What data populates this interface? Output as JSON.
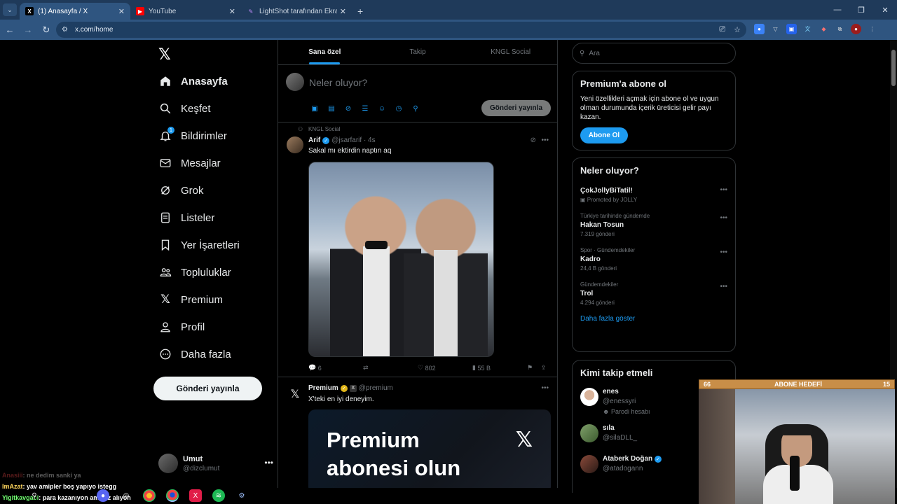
{
  "browser": {
    "tabs": [
      {
        "title": "(1) Anasayfa / X",
        "active": true
      },
      {
        "title": "YouTube",
        "active": false
      },
      {
        "title": "LightShot tarafından Ekran Gör",
        "active": false
      }
    ],
    "url": "x.com/home"
  },
  "sidebar": {
    "items": [
      {
        "label": "Anasayfa",
        "icon": "home-icon"
      },
      {
        "label": "Keşfet",
        "icon": "search-icon"
      },
      {
        "label": "Bildirimler",
        "icon": "bell-icon",
        "badge": "1"
      },
      {
        "label": "Mesajlar",
        "icon": "mail-icon"
      },
      {
        "label": "Grok",
        "icon": "grok-icon"
      },
      {
        "label": "Listeler",
        "icon": "list-icon"
      },
      {
        "label": "Yer İşaretleri",
        "icon": "bookmark-icon"
      },
      {
        "label": "Topluluklar",
        "icon": "communities-icon"
      },
      {
        "label": "Premium",
        "icon": "x-logo-icon"
      },
      {
        "label": "Profil",
        "icon": "profile-icon"
      },
      {
        "label": "Daha fazla",
        "icon": "more-circle-icon"
      }
    ],
    "post_button": "Gönderi yayınla",
    "user": {
      "name": "Umut",
      "handle": "@dizclumut"
    }
  },
  "main": {
    "tabs": [
      "Sana özel",
      "Takip",
      "KNGL Social"
    ],
    "compose": {
      "placeholder": "Neler oluyor?",
      "post_button": "Gönderi yayınla"
    },
    "posts": [
      {
        "context": "KNGL Social",
        "name": "Arif",
        "handle": "@jsarfarif · 4s",
        "text": "Sakal mı ektirdin naptın aq",
        "replies": "6",
        "likes": "802",
        "views": "55 B"
      },
      {
        "name": "Premium",
        "handle": "@premium",
        "text": "X'teki en iyi deneyim.",
        "promo_line1": "Premium",
        "promo_line2": "abonesi olun"
      }
    ]
  },
  "right": {
    "search_placeholder": "Ara",
    "premium": {
      "title": "Premium'a abone ol",
      "text": "Yeni özellikleri açmak için abone ol ve uygun olman durumunda içerik üreticisi gelir payı kazan.",
      "button": "Abone Ol"
    },
    "trends": {
      "title": "Neler oluyor?",
      "items": [
        {
          "meta": "",
          "title": "ÇokJollyBiTatil!",
          "count": "Promoted by JOLLY"
        },
        {
          "meta": "Türkiye tarihinde gündemde",
          "title": "Hakan Tosun",
          "count": "7.319 gönderi"
        },
        {
          "meta": "Spor · Gündemdekiler",
          "title": "Kadro",
          "count": "24,4 B gönderi"
        },
        {
          "meta": "Gündemdekiler",
          "title": "Trol",
          "count": "4.294 gönderi"
        }
      ],
      "show_more": "Daha fazla göster"
    },
    "who_to_follow": {
      "title": "Kimi takip etmeli",
      "items": [
        {
          "name": "enes",
          "handle": "@enessyri",
          "extra": "Parodi hesabı"
        },
        {
          "name": "sıla",
          "handle": "@silaDLL_",
          "extra": ""
        },
        {
          "name": "Ataberk Doğan",
          "handle": "@atadogann",
          "extra": ""
        }
      ]
    }
  },
  "overlay": {
    "goal": {
      "left": "66",
      "title": "ABONE HEDEFİ",
      "right": "15"
    },
    "chat": [
      {
        "user": "Anasiii",
        "msg": ": ne dedim sanki ya"
      },
      {
        "user": "ImAzat",
        "msg": ": yav amipler boş yapıyo istegg"
      },
      {
        "user": "Yigitkavgaci",
        "msg": ": para kazanıyon ama az alıyon"
      }
    ]
  }
}
